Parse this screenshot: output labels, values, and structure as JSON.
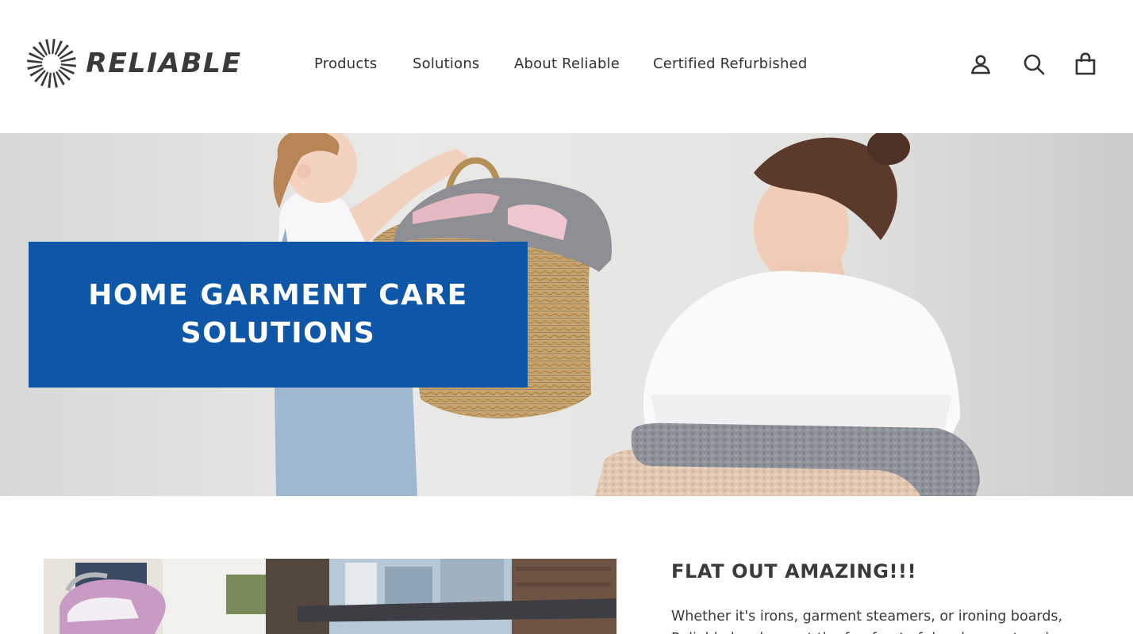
{
  "brand": {
    "name": "RELIABLE",
    "text_color": "#3a3a3a"
  },
  "nav": {
    "items": [
      {
        "label": "Products"
      },
      {
        "label": "Solutions"
      },
      {
        "label": "About Reliable"
      },
      {
        "label": "Certified Refurbished"
      }
    ]
  },
  "header_icons": [
    {
      "name": "account-icon"
    },
    {
      "name": "search-icon"
    },
    {
      "name": "cart-icon"
    }
  ],
  "hero": {
    "title": "HOME GARMENT CARE\nSOLUTIONS",
    "banner_color": "#0e57a8",
    "image": "child handing woven laundry basket to smiling woman holding folded blankets"
  },
  "feature": {
    "title": "FLAT OUT AMAZING!!!",
    "body": "Whether it's irons, garment steamers, or ironing boards, Reliable has been at the forefront of development and",
    "image": "steam iron on ironing board in bright living room"
  }
}
